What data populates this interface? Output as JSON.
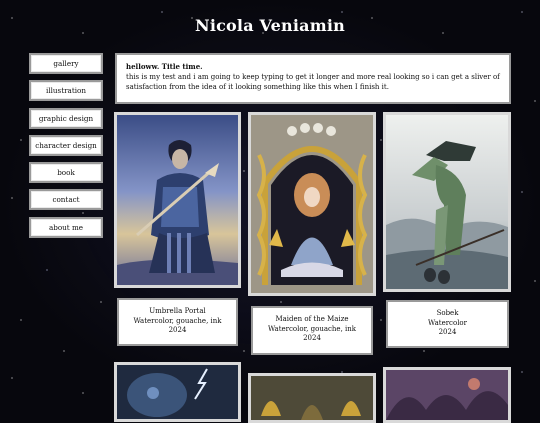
{
  "site": {
    "title": "Nicola Veniamin"
  },
  "nav": {
    "items": [
      {
        "label": "gallery"
      },
      {
        "label": "illustration"
      },
      {
        "label": "graphic design"
      },
      {
        "label": "character design"
      },
      {
        "label": "book"
      },
      {
        "label": "contact"
      },
      {
        "label": "about me"
      }
    ]
  },
  "intro": {
    "title": "helloww. Title time.",
    "body": "this is my test and i am going to keep typing to get it longer and more real looking so i can get a sliver of satisfaction from the idea of it looking something like this when I finish it."
  },
  "artworks": [
    {
      "title": "Umbrella Portal",
      "medium": "Watercolor, gouache, ink",
      "year": "2024"
    },
    {
      "title": "Maiden of the Maize",
      "medium": "Watercolor, gouache, ink",
      "year": "2024"
    },
    {
      "title": "Sobek",
      "medium": "Watercolor",
      "year": "2024"
    }
  ],
  "icons": [
    "umbrella-portal-artwork",
    "maiden-of-the-maize-artwork",
    "sobek-artwork",
    "storm-artwork",
    "golden-leaves-artwork",
    "purple-forest-artwork"
  ]
}
